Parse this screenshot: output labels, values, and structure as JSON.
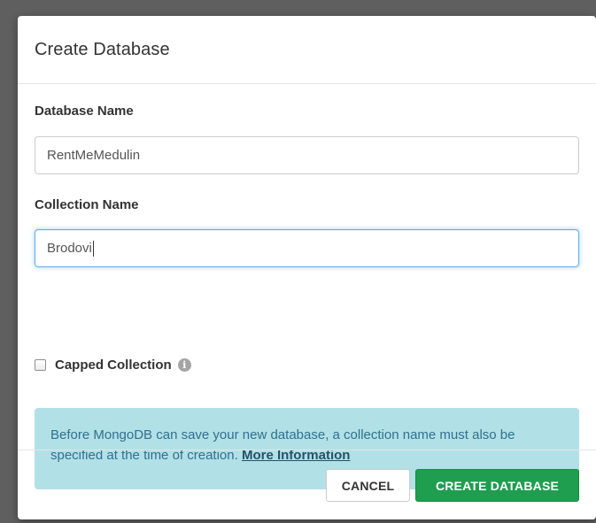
{
  "modal": {
    "title": "Create Database"
  },
  "form": {
    "database_name": {
      "label": "Database Name",
      "value": "RentMeMedulin"
    },
    "collection_name": {
      "label": "Collection Name",
      "value": "Brodovi"
    },
    "capped_collection": {
      "label": "Capped Collection",
      "checked": false,
      "info_icon": "info-circle-icon"
    }
  },
  "alert": {
    "text": "Before MongoDB can save your new database, a collection name must also be specified at the time of creation. ",
    "link_text": "More Information"
  },
  "footer": {
    "cancel_label": "CANCEL",
    "create_label": "CREATE DATABASE"
  },
  "colors": {
    "primary_button": "#1f9e50",
    "alert_background": "#b1e0e6",
    "focus_border": "#66afe9"
  }
}
